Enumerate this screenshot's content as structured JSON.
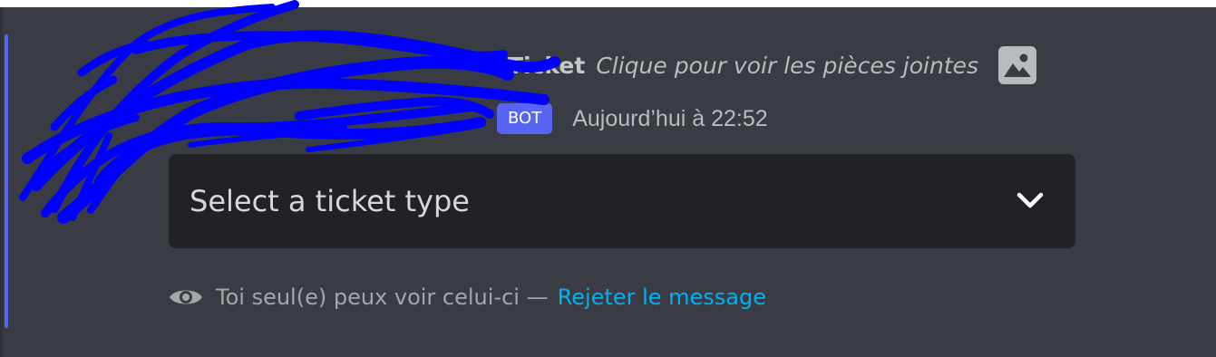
{
  "message": {
    "reply_preview": {
      "bot_name": "Ticket",
      "attachment_text": "Clique pour voir les pièces jointes",
      "attachment_icon": "image-icon"
    },
    "author": {
      "bot_tag": "BOT",
      "timestamp": "Aujourd’hui à 22:52"
    },
    "select_menu": {
      "placeholder": "Select a ticket type",
      "icon": "chevron-down-icon"
    },
    "ephemeral_notice": {
      "icon": "eye-icon",
      "text": "Toi seul(e) peux voir celui-ci —",
      "dismiss_label": "Rejeter le message"
    }
  },
  "colors": {
    "background": "#393c43",
    "accent": "#5865f2",
    "select_background": "#202225",
    "link": "#00aff4",
    "redaction": "#0000ff"
  }
}
